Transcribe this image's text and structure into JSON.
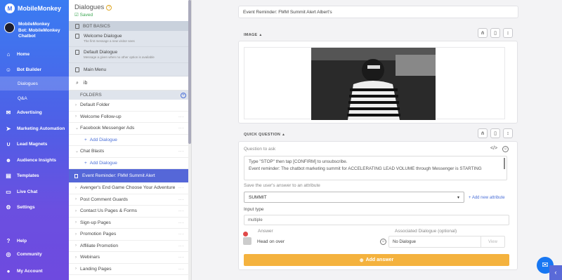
{
  "brand": {
    "name": "MobileMonkey",
    "logo": "M"
  },
  "account": {
    "name": "MobileMonkey",
    "bot": "Bot: MobileMonkey Chatbot"
  },
  "nav": {
    "home": "Home",
    "bot_builder": "Bot Builder",
    "dialogues": "Dialogues",
    "qa": "Q&A",
    "advertising": "Advertising",
    "marketing_automation": "Marketing Automation",
    "lead_magnets": "Lead Magnets",
    "audience_insights": "Audience Insights",
    "templates": "Templates",
    "live_chat": "Live Chat",
    "settings": "Settings",
    "help": "Help",
    "community": "Community",
    "my_account": "My Account"
  },
  "panel": {
    "title": "Dialogues",
    "help_glyph": "?",
    "saved": "Saved",
    "bot_basics_label": "BOT BASICS",
    "welcome": {
      "name": "Welcome Dialogue",
      "desc": "The first message a new visitor sees"
    },
    "default": {
      "name": "Default Dialogue",
      "desc": "Message a given when no other option is available"
    },
    "main_menu": "Main Menu",
    "search_value": "ib",
    "folders_label": "FOLDERS",
    "add_dialogue": "Add Dialogue",
    "active_item": "Event Reminder: FMM Summit Alert",
    "folders": {
      "default_folder": "Default Folder",
      "welcome_followup": "Welcome Follow-up",
      "fb_ads": "Facebook Messenger Ads",
      "chat_blasts": "Chat Blasts",
      "avengers": "Avenger's End Game Choose Your Adventure",
      "post_comment": "Post Comment Guards",
      "contact_us": "Contact Us Pages & Forms",
      "signup": "Sign-up Pages",
      "promotion": "Promotion Pages",
      "affiliate": "Affiliate Promotion",
      "webinars": "Webinars",
      "landing": "Landing Pages"
    },
    "more": "···"
  },
  "editor": {
    "dialogue_title": "Event Reminder: FMM Summit Alert Albert's",
    "image_label": "IMAGE",
    "quick_question_label": "QUICK QUESTION",
    "question_placeholder": "Question to ask",
    "message_line1": "Type \"STOP\" then tap [CONFIRM] to unsubscribe.",
    "message_line2": "Event reminder: The chatbot marketing summit for ACCELERATING LEAD VOLUME through Messenger is STARTING",
    "save_answer_label": "Save the user's answer to an attribute",
    "attribute_value": "SUMMIT",
    "add_attribute": "+ Add new attribute",
    "input_type_label": "Input type",
    "input_type_value": "multiple",
    "answer_header": "Answer",
    "assoc_header": "Associated Dialogue (optional)",
    "answer_value": "Head on over",
    "no_dialogue": "No Dialogue",
    "view": "View",
    "add_answer": "Add answer"
  },
  "colors": {
    "accent": "#5567d8",
    "add_answer": "#f4b23e",
    "saved": "#3aa650"
  }
}
